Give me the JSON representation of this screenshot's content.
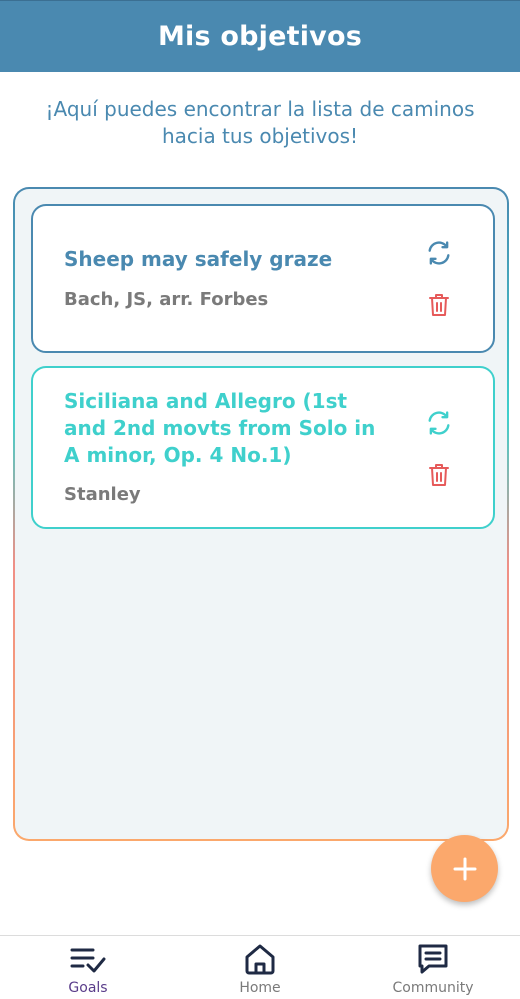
{
  "header": {
    "title": "Mis objetivos"
  },
  "intro": {
    "text": "¡Aquí puedes encontrar la lista de caminos hacia tus objetivos!"
  },
  "goals": [
    {
      "title": "Sheep may  safely graze",
      "author": "Bach, JS,  arr. Forbes",
      "refresh_icon": "refresh-icon",
      "delete_icon": "trash-icon"
    },
    {
      "title": "Siciliana and Allegro (1st and 2nd movts from Solo in A minor, Op. 4 No.1)",
      "author": "Stanley",
      "refresh_icon": "refresh-icon",
      "delete_icon": "trash-icon"
    }
  ],
  "fab": {
    "icon": "plus-icon"
  },
  "nav": {
    "items": [
      {
        "label": "Goals",
        "icon": "goals-checklist-icon",
        "active": true
      },
      {
        "label": "Home",
        "icon": "home-icon",
        "active": false
      },
      {
        "label": "Community",
        "icon": "chat-icon",
        "active": false
      }
    ]
  },
  "colors": {
    "primary": "#4a89b0",
    "teal": "#3fd0cc",
    "orange": "#fba86c",
    "delete": "#e65a5a",
    "active_nav": "#5a3d8a"
  }
}
